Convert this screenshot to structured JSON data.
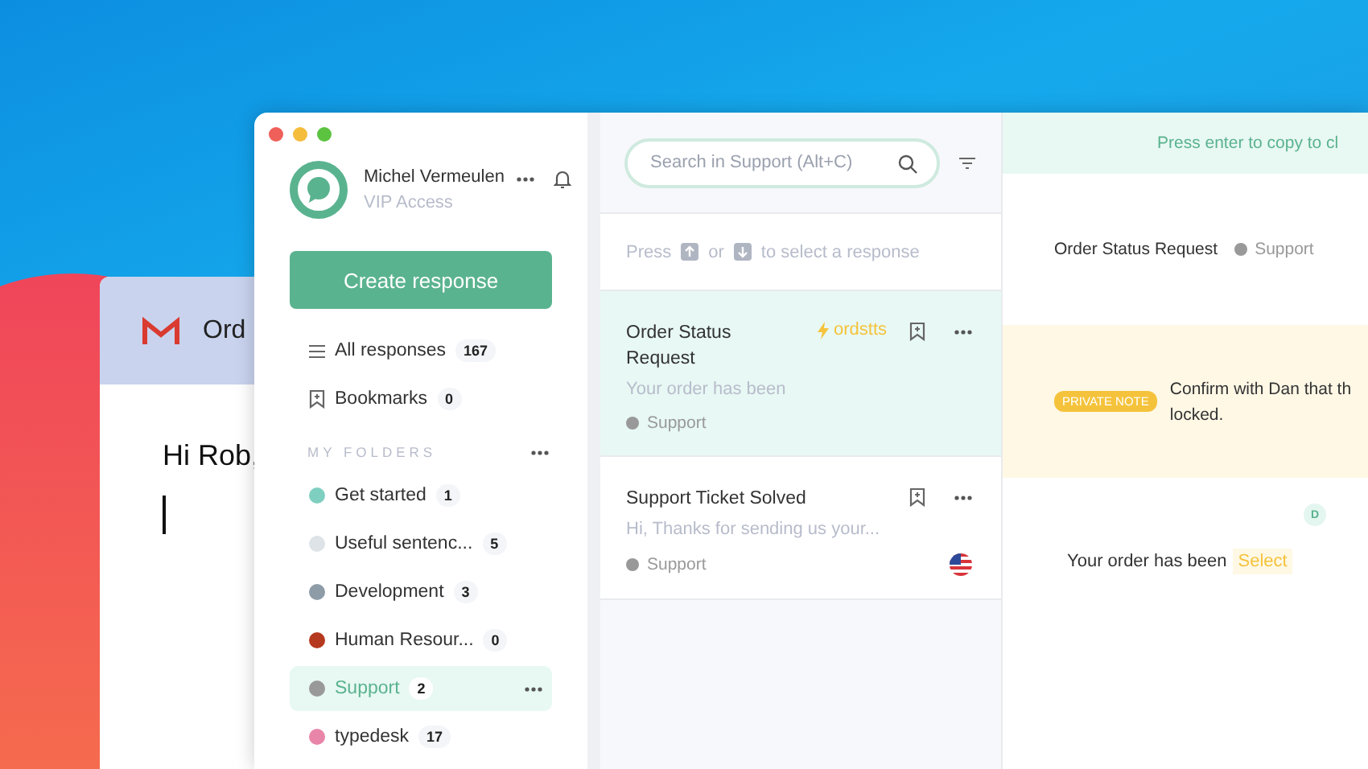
{
  "mail_window": {
    "subject": "Ord",
    "greeting": "Hi Rob,"
  },
  "sidebar": {
    "user": {
      "name": "Michel Vermeulen",
      "plan": "VIP Access"
    },
    "create_button": "Create response",
    "nav": [
      {
        "kind": "list",
        "label": "All responses",
        "count": "167"
      },
      {
        "kind": "bookmark",
        "label": "Bookmarks",
        "count": "0"
      }
    ],
    "folders_heading": "MY FOLDERS",
    "folders": [
      {
        "name": "Get started",
        "count": "1",
        "color": "#7fcfc0",
        "selected": false
      },
      {
        "name": "Useful sentenc...",
        "count": "5",
        "color": "#dde3e6",
        "selected": false
      },
      {
        "name": "Development",
        "count": "3",
        "color": "#8e9ca8",
        "selected": false
      },
      {
        "name": "Human Resour...",
        "count": "0",
        "color": "#b5391e",
        "selected": false
      },
      {
        "name": "Support",
        "count": "2",
        "color": "#999999",
        "selected": true
      },
      {
        "name": "typedesk",
        "count": "17",
        "color": "#e985a8",
        "selected": false
      }
    ]
  },
  "list": {
    "search": {
      "placeholder": "Search in Support (Alt+C)"
    },
    "hint": {
      "before": "Press",
      "middle": "or",
      "after": "to select a response"
    },
    "responses": [
      {
        "title": "Order Status Request",
        "shortcut": "ordstts",
        "preview": "Your order has been",
        "folder": "Support",
        "selected": true,
        "flag": false
      },
      {
        "title": "Support Ticket Solved",
        "preview": "Hi, Thanks for sending us your...",
        "folder": "Support",
        "selected": false,
        "flag": true
      }
    ]
  },
  "detail": {
    "banner": "Press enter to copy to cl",
    "title": "Order Status Request",
    "folder": "Support",
    "note": {
      "badge": "PRIVATE NOTE",
      "lines": [
        "Confirm with Dan that th",
        "locked."
      ]
    },
    "author_initial": "D",
    "body": "Your order has been",
    "select_label": "Select"
  }
}
